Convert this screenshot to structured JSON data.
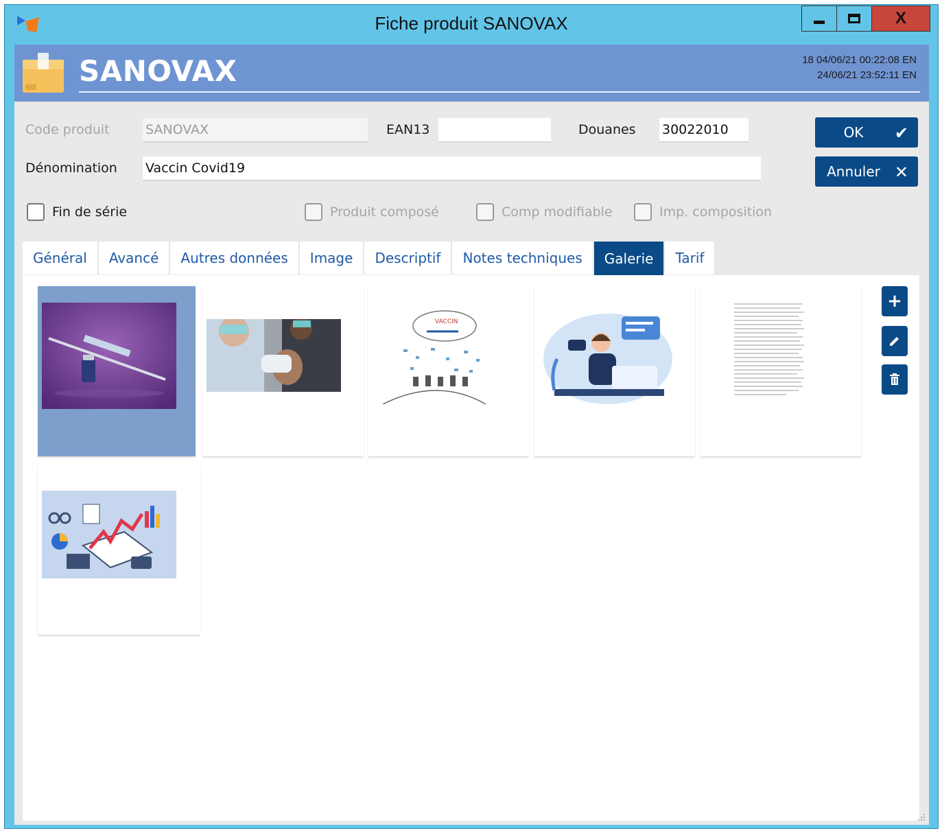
{
  "window": {
    "title": "Fiche produit SANOVAX",
    "close_label": "X"
  },
  "header": {
    "title": "SANOVAX",
    "meta_line1": "18  04/06/21 00:22:08  EN",
    "meta_line2": "24/06/21 23:52:11  EN"
  },
  "form": {
    "code_label": "Code produit",
    "code_value": "SANOVAX",
    "ean_label": "EAN13",
    "ean_value": "",
    "douanes_label": "Douanes",
    "douanes_value": "30022010",
    "denomination_label": "Dénomination",
    "denomination_value": "Vaccin Covid19",
    "checkboxes": [
      {
        "label": "Fin de série",
        "checked": false,
        "enabled": true
      },
      {
        "label": "Produit composé",
        "checked": false,
        "enabled": false
      },
      {
        "label": "Comp modifiable",
        "checked": false,
        "enabled": false
      },
      {
        "label": "Imp. composition",
        "checked": false,
        "enabled": false
      }
    ]
  },
  "actions": {
    "ok_label": "OK",
    "cancel_label": "Annuler"
  },
  "tabs": [
    {
      "label": "Général",
      "active": false
    },
    {
      "label": "Avancé",
      "active": false
    },
    {
      "label": "Autres données",
      "active": false
    },
    {
      "label": "Image",
      "active": false
    },
    {
      "label": "Descriptif",
      "active": false
    },
    {
      "label": "Notes techniques",
      "active": false
    },
    {
      "label": "Galerie",
      "active": true
    },
    {
      "label": "Tarif",
      "active": false
    }
  ],
  "gallery": {
    "items": [
      {
        "name": "vaccine-syringe-image",
        "selected": true
      },
      {
        "name": "injection-photo",
        "selected": false
      },
      {
        "name": "vaccine-sketch-illustration",
        "selected": false
      },
      {
        "name": "support-agent-illustration",
        "selected": false
      },
      {
        "name": "text-document-scan",
        "selected": false
      },
      {
        "name": "business-analytics-illustration",
        "selected": false
      }
    ],
    "sketch_caption": "VACCIN",
    "buttons": [
      "add-icon",
      "edit-icon",
      "delete-icon"
    ]
  },
  "colors": {
    "titlebar": "#62c5e8",
    "header_band": "#6f94d2",
    "accent": "#0a4a86",
    "tab_text": "#1f5aa6",
    "close_button": "#c8453c"
  }
}
